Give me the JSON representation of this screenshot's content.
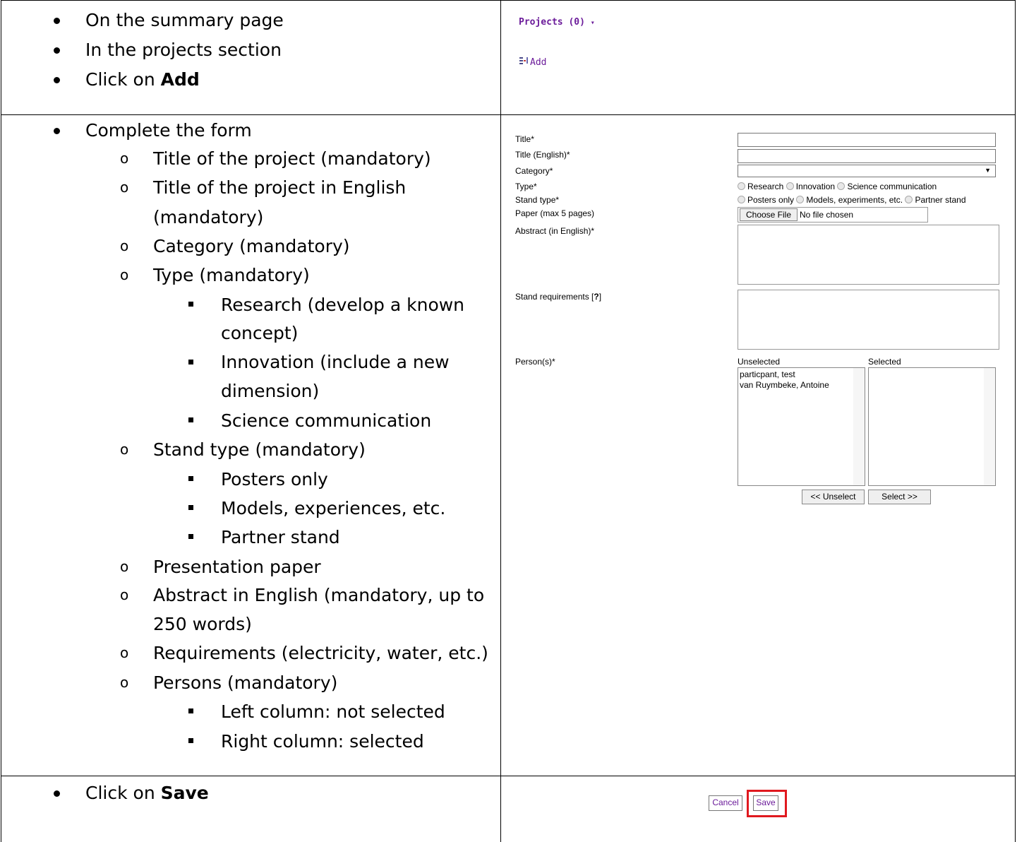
{
  "row1": {
    "bullets": [
      "On the summary page",
      "In the projects section"
    ],
    "click_prefix": "Click on ",
    "click_bold": "Add",
    "projects_header": "Projects (0)",
    "add_link": "Add"
  },
  "row2": {
    "main_bullet": "Complete the form",
    "items": {
      "title": "Title of the project (mandatory)",
      "title_en_1": "Title of the project in English",
      "title_en_2": "(mandatory)",
      "category": "Category (mandatory)",
      "type": "Type (mandatory)",
      "research_1": "Research (develop a known",
      "research_2": "concept)",
      "innovation_1": "Innovation (include a new",
      "innovation_2": "dimension)",
      "scicomm": "Science communication",
      "stand": "Stand type (mandatory)",
      "posters": "Posters only",
      "models": "Models, experiences, etc.",
      "partner": "Partner stand",
      "paper": "Presentation paper",
      "abstract_1": "Abstract in English (mandatory, up to",
      "abstract_2": "250 words)",
      "requirements": "Requirements (electricity, water, etc.)",
      "persons": "Persons (mandatory)",
      "left_col": "Left column: not selected",
      "right_col": "Right column: selected"
    },
    "form": {
      "labels": {
        "title": "Title*",
        "title_en": "Title (English)*",
        "category": "Category*",
        "type": "Type*",
        "stand_type": "Stand type*",
        "paper": "Paper (max 5 pages)",
        "abstract": "Abstract (in English)*",
        "stand_req": "Stand requirements [",
        "stand_req_q": "?",
        "stand_req_end": "]",
        "persons": "Person(s)*"
      },
      "type_options": [
        "Research",
        "Innovation",
        "Science communication"
      ],
      "stand_options": [
        "Posters only",
        "Models, experiments, etc.",
        "Partner stand"
      ],
      "choose_file": "Choose File",
      "no_file": "No file chosen",
      "unselected_label": "Unselected",
      "selected_label": "Selected",
      "unselected_items": [
        "particpant, test",
        "van Ruymbeke, Antoine"
      ],
      "unselect_btn": "<< Unselect",
      "select_btn": "Select >>"
    }
  },
  "row3": {
    "click_prefix": "Click on ",
    "click_bold": "Save",
    "cancel": "Cancel",
    "save": "Save",
    "highlight_color": "#e0191f"
  }
}
